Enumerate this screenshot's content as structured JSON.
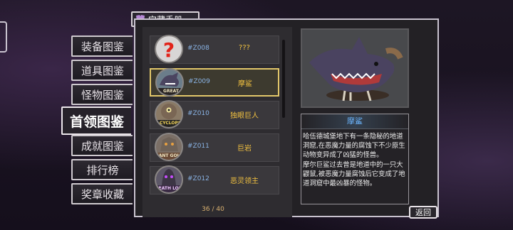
{
  "header": {
    "title": "宝藏手册",
    "icon": "book-icon"
  },
  "tabs": [
    {
      "label": "装备图鉴",
      "active": false
    },
    {
      "label": "道具图鉴",
      "active": false
    },
    {
      "label": "怪物图鉴",
      "active": false
    },
    {
      "label": "首领图鉴",
      "active": true
    },
    {
      "label": "成就图鉴",
      "active": false
    },
    {
      "label": "排行榜",
      "active": false
    },
    {
      "label": "奖章收藏",
      "active": false
    }
  ],
  "entries": [
    {
      "code": "#Z008",
      "name": "???",
      "banner": "",
      "icon": "question-mark-icon",
      "selected": false
    },
    {
      "code": "#Z009",
      "name": "摩鲨",
      "banner": "GREAT MOULSHARK",
      "icon": "shark-boss-icon",
      "selected": true
    },
    {
      "code": "#Z010",
      "name": "独眼巨人",
      "banner": "CYCLOPS",
      "icon": "cyclops-boss-icon",
      "selected": false
    },
    {
      "code": "#Z011",
      "name": "巨岩",
      "banner": "GIANT GOLEM",
      "icon": "golem-boss-icon",
      "selected": false
    },
    {
      "code": "#Z012",
      "name": "恶灵领主",
      "banner": "DEATH LORD",
      "icon": "death-lord-boss-icon",
      "selected": false
    }
  ],
  "pagination": "36 / 40",
  "detail": {
    "name": "摩鲨",
    "image": "land-shark-monster",
    "description": [
      "哈伍德城堡地下有一条隐秘的地道洞窟,在恶魔力量的腐蚀下不少原生动物变异成了凶猛的怪兽。",
      "摩尔巨鲨过去曾是地道中的一只大鼹鼠,被恶魔力量腐蚀后它变成了地道洞窟中最凶暴的怪物。"
    ]
  },
  "back_label": "返回"
}
